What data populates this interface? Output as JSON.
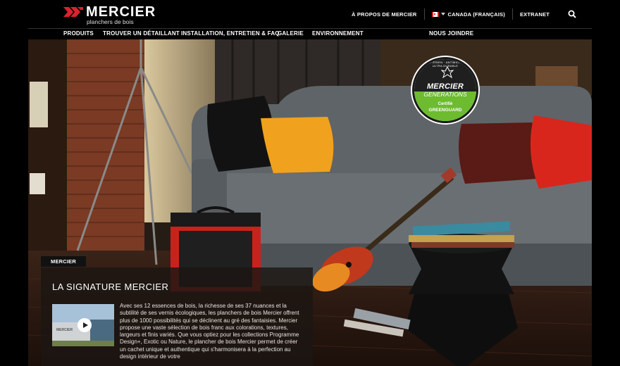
{
  "brand": {
    "name": "MERCIER",
    "tagline": "planchers de bois"
  },
  "utility": {
    "about": "À PROPOS DE MERCIER",
    "region": "CANADA (FRANÇAIS)",
    "extranet": "EXTRANET",
    "search_icon": "search-icon"
  },
  "nav": {
    "items": [
      "PRODUITS",
      "TROUVER UN DÉTAILLANT",
      "INSTALLATION, ENTRETIEN & FAQ",
      "GALERIE",
      "ENVIRONNEMENT"
    ],
    "contact": "NOUS JOINDRE"
  },
  "badge": {
    "arc_text": "ANTIBACTÉRIEN · ANTIMICROBIEN · ULTRA DURABLE",
    "brand": "MERCIER",
    "line": "GENERATIONS",
    "cert": "Certifié",
    "cert_name": "GREENGUARD"
  },
  "content": {
    "tag": "MERCIER",
    "title": "LA SIGNATURE MERCIER",
    "video_label": "MERCIER",
    "body": "Avec ses 12 essences de bois, la richesse de ses 37 nuances et la subtilité de ses vernis écologiques, les planchers de bois Mercier offrent plus de 1000 possibilités qui se déclinent au gré des fantaisies. Mercier propose une vaste sélection de bois franc aux colorations, textures, largeurs et finis variés. Que vous optiez pour les collections Programme Design+, Exotic ou Nature, le plancher de bois Mercier permet de créer un cachet unique et authentique qui s'harmonisera à la perfection au design intérieur de votre"
  },
  "colors": {
    "header_bg": "#000000",
    "badge_green": "#6dbb2f",
    "logo_red": "#d9232e"
  }
}
